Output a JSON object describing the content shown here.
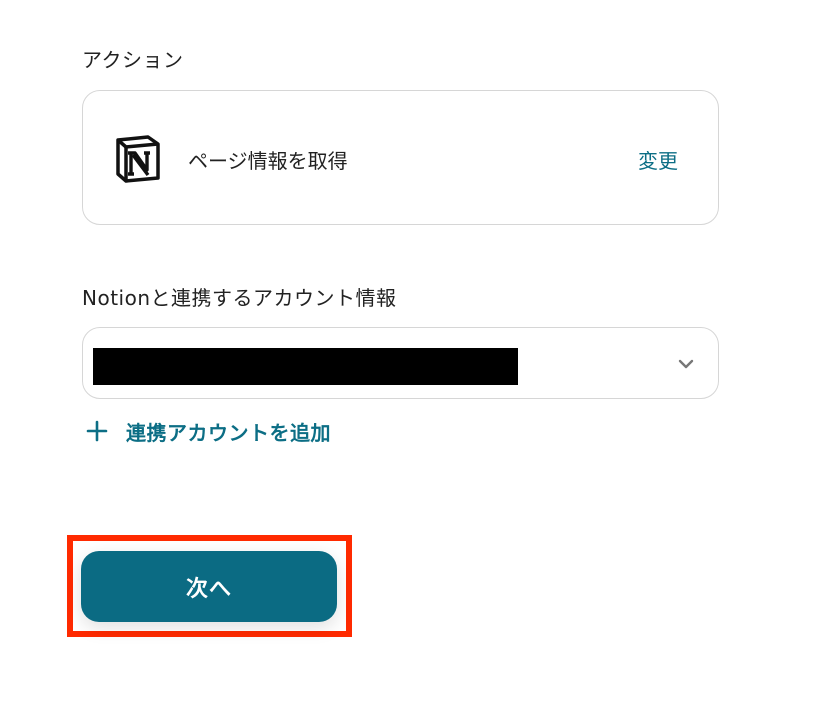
{
  "action": {
    "section_label": "アクション",
    "app_icon": "notion-logo-icon",
    "title": "ページ情報を取得",
    "change_label": "変更"
  },
  "account": {
    "section_label": "Notionと連携するアカウント情報",
    "selected_value_redacted": true,
    "dropdown_icon": "chevron-down-icon",
    "add_label": "連携アカウントを追加",
    "add_icon": "plus-icon"
  },
  "footer": {
    "next_label": "次へ"
  },
  "colors": {
    "accent": "#0c6e85",
    "button_bg": "#0b6b83",
    "highlight": "#ff2a00",
    "border": "#d6d6d6"
  }
}
